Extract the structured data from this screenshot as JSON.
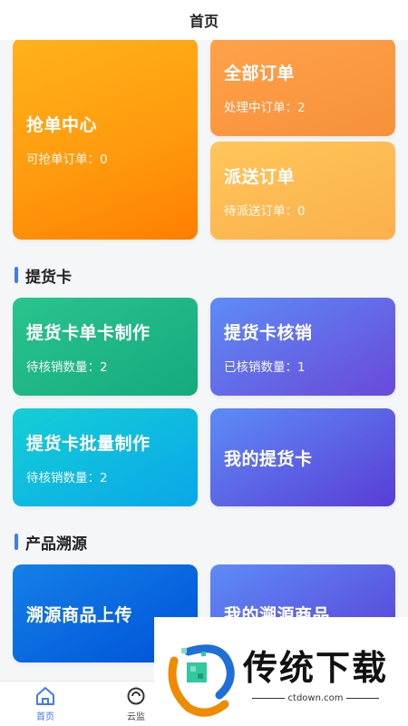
{
  "header": {
    "title": "首页"
  },
  "orders": {
    "grab": {
      "title": "抢单中心",
      "sub": "可抢单订单：0"
    },
    "all": {
      "title": "全部订单",
      "sub": "处理中订单：2"
    },
    "send": {
      "title": "派送订单",
      "sub": "待派送订单：0"
    }
  },
  "section_card": {
    "title": "提货卡"
  },
  "cards": {
    "single": {
      "title": "提货卡单卡制作",
      "sub": "待核销数量：2"
    },
    "verify": {
      "title": "提货卡核销",
      "sub": "已核销数量：1"
    },
    "batch": {
      "title": "提货卡批量制作",
      "sub": "待核销数量：2"
    },
    "mine": {
      "title": "我的提货卡"
    }
  },
  "section_trace": {
    "title": "产品溯源"
  },
  "trace": {
    "upload": {
      "title": "溯源商品上传"
    },
    "mine": {
      "title": "我的溯源商品"
    }
  },
  "tabbar": {
    "home": {
      "label": "首页",
      "icon": "home-icon"
    },
    "cloud": {
      "label": "云监",
      "icon": "cloud-monitor-icon"
    }
  },
  "watermark": {
    "big": "传统下载",
    "small": "ctdown.com"
  },
  "colors": {
    "accent": "#3d7cf2",
    "orange": "#ff9b0e",
    "green": "#16a97f",
    "purple": "#6a49d9"
  }
}
